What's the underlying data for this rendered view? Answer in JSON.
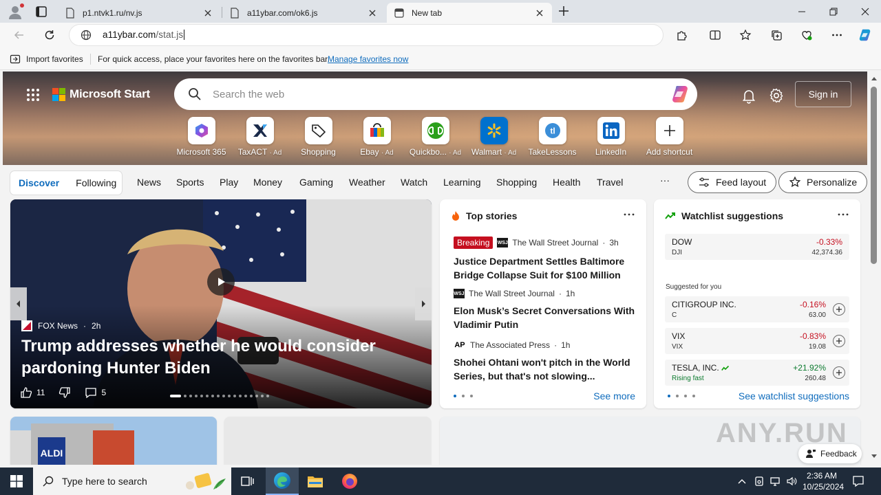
{
  "browser": {
    "tabs": [
      {
        "label": "p1.ntvk1.ru/nv.js",
        "active": false
      },
      {
        "label": "a11ybar.com/ok6.js",
        "active": false
      },
      {
        "label": "New tab",
        "active": true
      }
    ],
    "url_host": "a11ybar.com",
    "url_path": "/stat.js",
    "favorites_bar": {
      "import_label": "Import favorites",
      "hint": "For quick access, place your favorites here on the favorites bar.",
      "manage_link": "Manage favorites now"
    }
  },
  "page": {
    "brand": "Microsoft Start",
    "search_placeholder": "Search the web",
    "signin_label": "Sign in",
    "shortcuts": [
      {
        "label": "Microsoft 365",
        "ad": "",
        "icon": "microsoft-365-icon"
      },
      {
        "label": "TaxACT",
        "ad": "· Ad",
        "icon": "taxact-icon"
      },
      {
        "label": "Shopping",
        "ad": "",
        "icon": "shopping-tag-icon"
      },
      {
        "label": "Ebay",
        "ad": "· Ad",
        "icon": "ebay-icon"
      },
      {
        "label": "Quickbo...",
        "ad": "· Ad",
        "icon": "quickbooks-icon"
      },
      {
        "label": "Walmart",
        "ad": "· Ad",
        "icon": "walmart-icon"
      },
      {
        "label": "TakeLessons",
        "ad": "",
        "icon": "takelessons-icon"
      },
      {
        "label": "LinkedIn",
        "ad": "",
        "icon": "linkedin-icon"
      },
      {
        "label": "Add shortcut",
        "ad": "",
        "icon": "plus-icon"
      }
    ],
    "feed_toggle": {
      "discover": "Discover",
      "following": "Following"
    },
    "nav_links": [
      "News",
      "Sports",
      "Play",
      "Money",
      "Gaming",
      "Weather",
      "Watch",
      "Learning",
      "Shopping",
      "Health",
      "Travel"
    ],
    "more_label": "···",
    "feed_layout_label": "Feed layout",
    "personalize_label": "Personalize"
  },
  "hero_story": {
    "source": "FOX News",
    "age": "2h",
    "title": "Trump addresses whether he would consider pardoning Hunter Biden",
    "likes": "11",
    "comments": "5"
  },
  "top_stories": {
    "heading": "Top stories",
    "items": [
      {
        "badge": "Breaking",
        "logo": "WSJ",
        "source": "The Wall Street Journal",
        "age": "3h",
        "title": "Justice Department Settles Baltimore Bridge Collapse Suit for $100 Million"
      },
      {
        "badge": "",
        "logo": "WSJ",
        "source": "The Wall Street Journal",
        "age": "1h",
        "title": "Elon Musk’s Secret Conversations With Vladimir Putin"
      },
      {
        "badge": "",
        "logo": "AP",
        "source": "The Associated Press",
        "age": "1h",
        "title": "Shohei Ohtani won't pitch in the World Series, but that's not slowing..."
      }
    ],
    "see_more": "See more"
  },
  "watchlist": {
    "heading": "Watchlist suggestions",
    "index": {
      "name": "DOW",
      "symbol": "DJI",
      "change": "-0.33%",
      "price": "42,374.36"
    },
    "suggested_label": "Suggested for you",
    "items": [
      {
        "name": "CITIGROUP INC.",
        "symbol": "C",
        "change": "-0.16%",
        "price": "63.00",
        "direction": "down"
      },
      {
        "name": "VIX",
        "symbol": "VIX",
        "change": "-0.83%",
        "price": "19.08",
        "direction": "down"
      },
      {
        "name": "TESLA, INC.",
        "symbol": "Rising fast",
        "change": "+21.92%",
        "price": "260.48",
        "direction": "up"
      }
    ],
    "see_watchlist": "See watchlist suggestions"
  },
  "feedback_label": "Feedback",
  "watermark": "ANY.RUN",
  "taskbar": {
    "search_placeholder": "Type here to search",
    "time": "2:36 AM",
    "date": "10/25/2024"
  },
  "colors": {
    "accent": "#0f6cbd",
    "negative": "#c50f1f",
    "positive": "#0b7a2e",
    "taskbar": "#1f2b3a"
  }
}
